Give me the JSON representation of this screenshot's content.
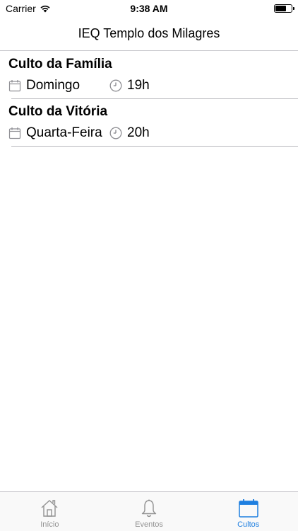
{
  "status_bar": {
    "carrier": "Carrier",
    "time": "9:38 AM",
    "battery_level": 0.7
  },
  "nav": {
    "title": "IEQ Templo dos Milagres"
  },
  "services": [
    {
      "name": "Culto da Família",
      "day": "Domingo",
      "time": "19h"
    },
    {
      "name": "Culto da Vitória",
      "day": "Quarta-Feira",
      "time": "20h"
    }
  ],
  "tabs": [
    {
      "label": "Início",
      "icon": "home-icon",
      "active": false
    },
    {
      "label": "Eventos",
      "icon": "bell-icon",
      "active": false
    },
    {
      "label": "Cultos",
      "icon": "calendar-icon",
      "active": true
    }
  ],
  "colors": {
    "accent": "#1e7fe0",
    "inactive": "#929292",
    "meta_icon": "#8e8e93",
    "divider": "#b8b8bd"
  }
}
